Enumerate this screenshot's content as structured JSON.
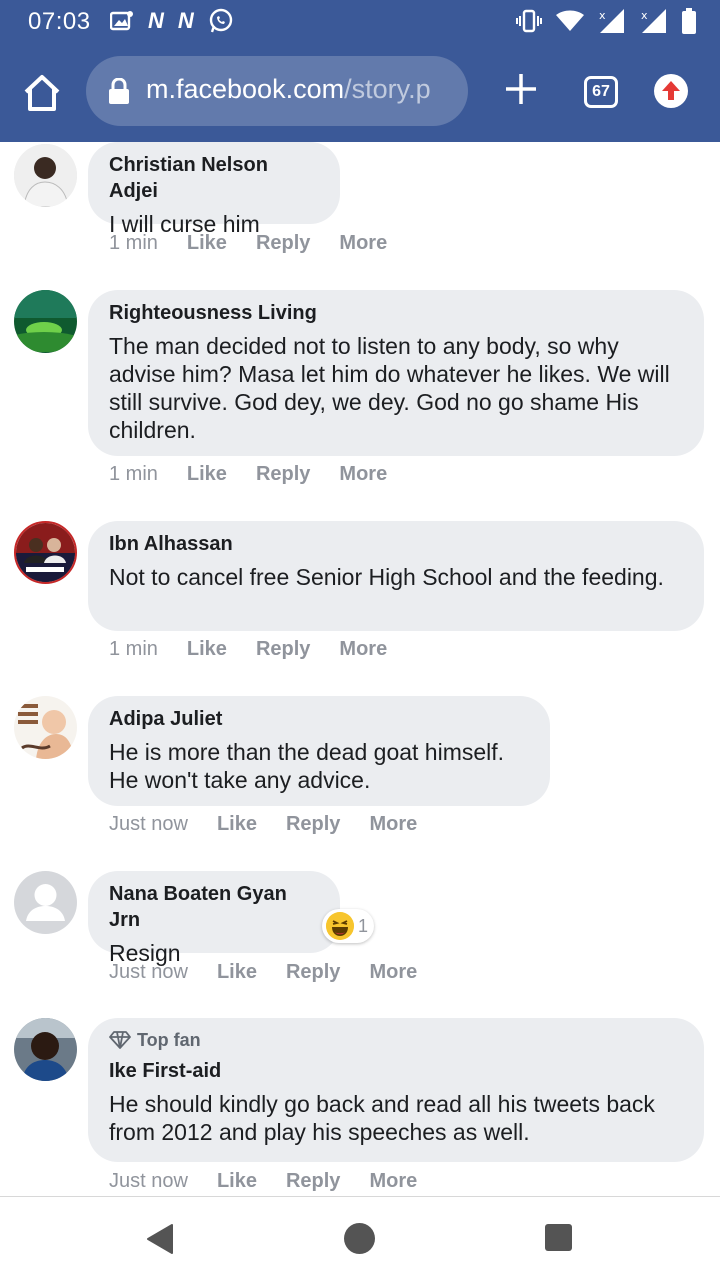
{
  "status_bar": {
    "time": "07:03",
    "left_icons": [
      "image-icon",
      "n-icon",
      "n-icon",
      "whatsapp-icon"
    ],
    "right_icons": [
      "vibrate-icon",
      "wifi-icon",
      "signal-icon",
      "signal-icon",
      "battery-icon"
    ],
    "n_glyph": "N"
  },
  "browser": {
    "url_host": "m.facebook.com",
    "url_path": "/story.p",
    "tab_count": "67"
  },
  "comments": [
    {
      "author": "Christian Nelson Adjei",
      "text": "I will curse him",
      "time": "1 min",
      "like": "Like",
      "reply": "Reply",
      "more": "More"
    },
    {
      "author": "Righteousness Living",
      "text": "The man decided not to listen to any body, so why advise him? Masa let him do whatever he likes. We will still survive. God dey, we dey. God no go shame His children.",
      "time": "1 min",
      "like": "Like",
      "reply": "Reply",
      "more": "More"
    },
    {
      "author": "Ibn Alhassan",
      "text": "Not to cancel free Senior High School and the feeding.",
      "time": "1 min",
      "like": "Like",
      "reply": "Reply",
      "more": "More"
    },
    {
      "author": "Adipa Juliet",
      "text": "He is more than the dead goat himself. He won't take any advice.",
      "time": "Just now",
      "like": "Like",
      "reply": "Reply",
      "more": "More"
    },
    {
      "author": "Nana Boaten Gyan Jrn",
      "text": "Resign",
      "time": "Just now",
      "like": "Like",
      "reply": "Reply",
      "more": "More",
      "reaction_count": "1"
    },
    {
      "badge": "Top fan",
      "author": "Ike First-aid",
      "text": "He should kindly go back and read all his tweets back from 2012 and play his speeches as well.",
      "time": "Just now",
      "like": "Like",
      "reply": "Reply",
      "more": "More"
    }
  ],
  "colors": {
    "brand": "#3b5998",
    "bubble": "#ebedf0",
    "meta_text": "#90949c"
  }
}
